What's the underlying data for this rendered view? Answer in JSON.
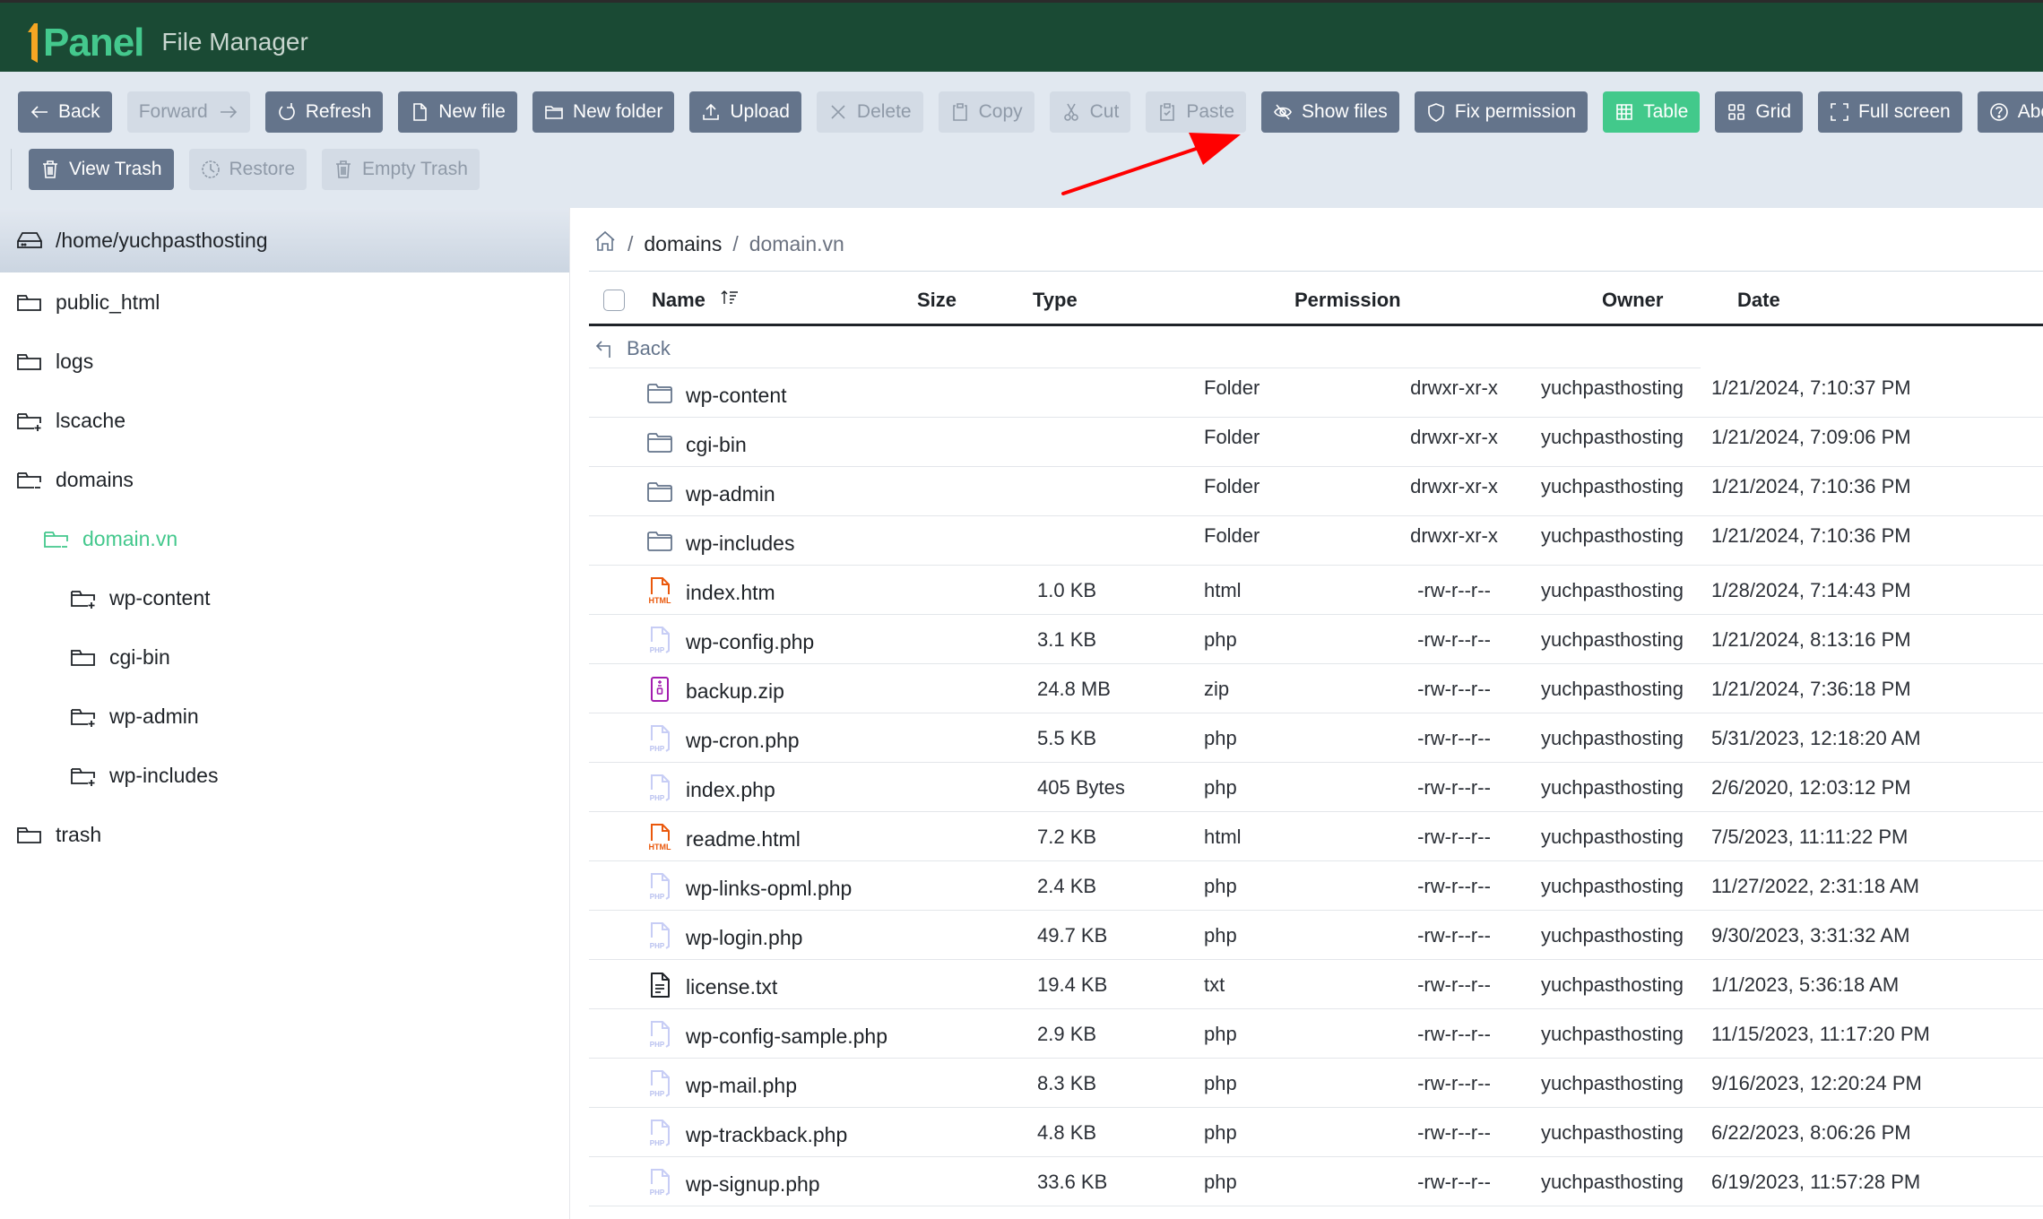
{
  "header": {
    "logo_text": "Panel",
    "app_title": "File Manager",
    "colors": {
      "bar": "#1a4a34",
      "brand_green": "#44c88d",
      "brand_orange": "#f5a623"
    }
  },
  "toolbar": {
    "row1": [
      {
        "id": "back",
        "label": "Back",
        "icon": "arrow-left-icon",
        "state": "enabled"
      },
      {
        "id": "forward",
        "label": "Forward",
        "icon": "arrow-right-icon",
        "state": "disabled"
      },
      {
        "id": "refresh",
        "label": "Refresh",
        "icon": "refresh-icon",
        "state": "enabled"
      },
      {
        "id": "new-file",
        "label": "New file",
        "icon": "file-icon",
        "state": "enabled"
      },
      {
        "id": "new-folder",
        "label": "New folder",
        "icon": "folder-icon",
        "state": "enabled"
      },
      {
        "id": "upload",
        "label": "Upload",
        "icon": "upload-icon",
        "state": "enabled"
      },
      {
        "id": "delete",
        "label": "Delete",
        "icon": "x-icon",
        "state": "disabled"
      },
      {
        "id": "copy",
        "label": "Copy",
        "icon": "clipboard-icon",
        "state": "disabled"
      },
      {
        "id": "cut",
        "label": "Cut",
        "icon": "scissors-icon",
        "state": "disabled"
      },
      {
        "id": "paste",
        "label": "Paste",
        "icon": "clipboard-check-icon",
        "state": "disabled"
      },
      {
        "id": "show-files",
        "label": "Show files",
        "icon": "eye-off-icon",
        "state": "enabled"
      },
      {
        "id": "fix-permission",
        "label": "Fix permission",
        "icon": "shield-icon",
        "state": "enabled"
      },
      {
        "id": "table",
        "label": "Table",
        "icon": "table-icon",
        "state": "active"
      },
      {
        "id": "grid",
        "label": "Grid",
        "icon": "grid-icon",
        "state": "enabled"
      },
      {
        "id": "full-screen",
        "label": "Full screen",
        "icon": "fullscreen-icon",
        "state": "enabled"
      },
      {
        "id": "about",
        "label": "About",
        "icon": "help-circle-icon",
        "state": "enabled"
      }
    ],
    "row2": [
      {
        "id": "view-trash",
        "label": "View Trash",
        "icon": "trash-icon",
        "state": "enabled"
      },
      {
        "id": "restore",
        "label": "Restore",
        "icon": "clock-icon",
        "state": "disabled"
      },
      {
        "id": "empty-trash",
        "label": "Empty Trash",
        "icon": "trash-icon",
        "state": "disabled"
      }
    ]
  },
  "sidebar": {
    "root": "/home/yuchpasthosting",
    "items": [
      {
        "label": "public_html",
        "level": 0,
        "icon": "folder-open-icon",
        "selected": false
      },
      {
        "label": "logs",
        "level": 0,
        "icon": "folder-open-icon",
        "selected": false
      },
      {
        "label": "lscache",
        "level": 0,
        "icon": "folder-plus-icon",
        "selected": false
      },
      {
        "label": "domains",
        "level": 0,
        "icon": "folder-minus-icon",
        "selected": false
      },
      {
        "label": "domain.vn",
        "level": 1,
        "icon": "folder-minus-icon",
        "selected": true
      },
      {
        "label": "wp-content",
        "level": 2,
        "icon": "folder-plus-icon",
        "selected": false
      },
      {
        "label": "cgi-bin",
        "level": 2,
        "icon": "folder-open-icon",
        "selected": false
      },
      {
        "label": "wp-admin",
        "level": 2,
        "icon": "folder-plus-icon",
        "selected": false
      },
      {
        "label": "wp-includes",
        "level": 2,
        "icon": "folder-plus-icon",
        "selected": false
      },
      {
        "label": "trash",
        "level": 0,
        "icon": "folder-open-icon",
        "selected": false
      }
    ]
  },
  "breadcrumb": {
    "home_icon": "home-icon",
    "items": [
      "domains",
      "domain.vn"
    ],
    "separator": "/"
  },
  "table": {
    "columns": {
      "name": "Name",
      "size": "Size",
      "type": "Type",
      "permission": "Permission",
      "owner": "Owner",
      "date": "Date"
    },
    "back_label": "Back",
    "rows": [
      {
        "name": "wp-content",
        "size": "",
        "type": "Folder",
        "permission": "drwxr-xr-x",
        "owner": "yuchpasthosting",
        "date": "1/21/2024, 7:10:37 PM",
        "kind": "folder"
      },
      {
        "name": "cgi-bin",
        "size": "",
        "type": "Folder",
        "permission": "drwxr-xr-x",
        "owner": "yuchpasthosting",
        "date": "1/21/2024, 7:09:06 PM",
        "kind": "folder"
      },
      {
        "name": "wp-admin",
        "size": "",
        "type": "Folder",
        "permission": "drwxr-xr-x",
        "owner": "yuchpasthosting",
        "date": "1/21/2024, 7:10:36 PM",
        "kind": "folder"
      },
      {
        "name": "wp-includes",
        "size": "",
        "type": "Folder",
        "permission": "drwxr-xr-x",
        "owner": "yuchpasthosting",
        "date": "1/21/2024, 7:10:36 PM",
        "kind": "folder"
      },
      {
        "name": "index.htm",
        "size": "1.0 KB",
        "type": "html",
        "permission": "-rw-r--r--",
        "owner": "yuchpasthosting",
        "date": "1/28/2024, 7:14:43 PM",
        "kind": "html"
      },
      {
        "name": "wp-config.php",
        "size": "3.1 KB",
        "type": "php",
        "permission": "-rw-r--r--",
        "owner": "yuchpasthosting",
        "date": "1/21/2024, 8:13:16 PM",
        "kind": "php"
      },
      {
        "name": "backup.zip",
        "size": "24.8 MB",
        "type": "zip",
        "permission": "-rw-r--r--",
        "owner": "yuchpasthosting",
        "date": "1/21/2024, 7:36:18 PM",
        "kind": "zip"
      },
      {
        "name": "wp-cron.php",
        "size": "5.5 KB",
        "type": "php",
        "permission": "-rw-r--r--",
        "owner": "yuchpasthosting",
        "date": "5/31/2023, 12:18:20 AM",
        "kind": "php"
      },
      {
        "name": "index.php",
        "size": "405 Bytes",
        "type": "php",
        "permission": "-rw-r--r--",
        "owner": "yuchpasthosting",
        "date": "2/6/2020, 12:03:12 PM",
        "kind": "php"
      },
      {
        "name": "readme.html",
        "size": "7.2 KB",
        "type": "html",
        "permission": "-rw-r--r--",
        "owner": "yuchpasthosting",
        "date": "7/5/2023, 11:11:22 PM",
        "kind": "html"
      },
      {
        "name": "wp-links-opml.php",
        "size": "2.4 KB",
        "type": "php",
        "permission": "-rw-r--r--",
        "owner": "yuchpasthosting",
        "date": "11/27/2022, 2:31:18 AM",
        "kind": "php"
      },
      {
        "name": "wp-login.php",
        "size": "49.7 KB",
        "type": "php",
        "permission": "-rw-r--r--",
        "owner": "yuchpasthosting",
        "date": "9/30/2023, 3:31:32 AM",
        "kind": "php"
      },
      {
        "name": "license.txt",
        "size": "19.4 KB",
        "type": "txt",
        "permission": "-rw-r--r--",
        "owner": "yuchpasthosting",
        "date": "1/1/2023, 5:36:18 AM",
        "kind": "txt"
      },
      {
        "name": "wp-config-sample.php",
        "size": "2.9 KB",
        "type": "php",
        "permission": "-rw-r--r--",
        "owner": "yuchpasthosting",
        "date": "11/15/2023, 11:17:20 PM",
        "kind": "php"
      },
      {
        "name": "wp-mail.php",
        "size": "8.3 KB",
        "type": "php",
        "permission": "-rw-r--r--",
        "owner": "yuchpasthosting",
        "date": "9/16/2023, 12:20:24 PM",
        "kind": "php"
      },
      {
        "name": "wp-trackback.php",
        "size": "4.8 KB",
        "type": "php",
        "permission": "-rw-r--r--",
        "owner": "yuchpasthosting",
        "date": "6/22/2023, 8:06:26 PM",
        "kind": "php"
      },
      {
        "name": "wp-signup.php",
        "size": "33.6 KB",
        "type": "php",
        "permission": "-rw-r--r--",
        "owner": "yuchpasthosting",
        "date": "6/19/2023, 11:57:28 PM",
        "kind": "php"
      }
    ]
  },
  "annotation": {
    "type": "red-arrow",
    "points_to": "show-files",
    "color": "#ff0000"
  }
}
